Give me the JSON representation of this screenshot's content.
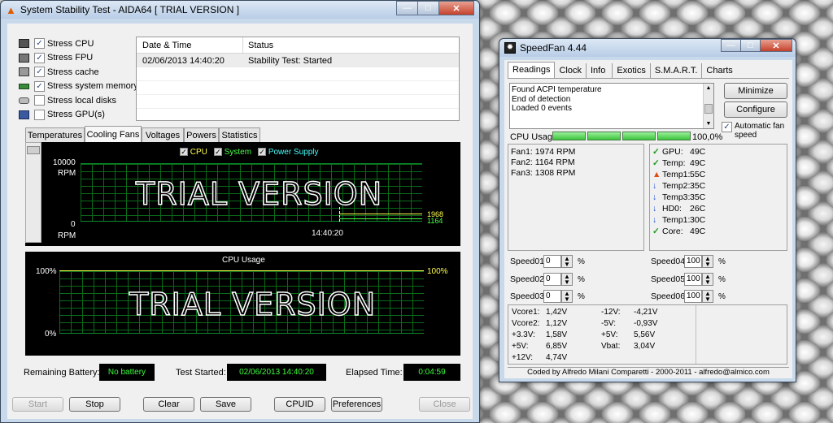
{
  "aida": {
    "title": "System Stability Test - AIDA64  [ TRIAL VERSION ]",
    "stress": [
      "Stress CPU",
      "Stress FPU",
      "Stress cache",
      "Stress system memory",
      "Stress local disks",
      "Stress GPU(s)"
    ],
    "stress_checked": [
      true,
      true,
      true,
      true,
      false,
      false
    ],
    "log_headers": [
      "Date & Time",
      "Status"
    ],
    "log": [
      {
        "time": "02/06/2013 14:40:20",
        "status": "Stability Test: Started"
      }
    ],
    "tabs": [
      "Temperatures",
      "Cooling Fans",
      "Voltages",
      "Powers",
      "Statistics"
    ],
    "active_tab": "Cooling Fans",
    "fan_legend": [
      "CPU",
      "System",
      "Power Supply"
    ],
    "fan_y_top": "10000",
    "fan_y_unit": "RPM",
    "fan_y_bottom": "0",
    "fan_y_bottom_unit": "RPM",
    "fan_time": "14:40:20",
    "fan_v1": "1968",
    "fan_v2": "1164",
    "trial": "TRIAL VERSION",
    "cpu_title": "CPU Usage",
    "cpu_top": "100%",
    "cpu_bottom": "0%",
    "cpu_right": "100%",
    "battery_label": "Remaining Battery:",
    "battery_value": "No battery",
    "started_label": "Test Started:",
    "started_value": "02/06/2013 14:40:20",
    "elapsed_label": "Elapsed Time:",
    "elapsed_value": "0:04:59",
    "buttons": {
      "start": "Start",
      "stop": "Stop",
      "clear": "Clear",
      "save": "Save",
      "cpuid": "CPUID",
      "prefs": "Preferences",
      "close": "Close"
    }
  },
  "speedfan": {
    "title": "SpeedFan 4.44",
    "tabs": [
      "Readings",
      "Clock",
      "Info",
      "Exotics",
      "S.M.A.R.T.",
      "Charts"
    ],
    "log": [
      "Found ACPI temperature",
      "End of detection",
      "Loaded 0 events"
    ],
    "minimize": "Minimize",
    "configure": "Configure",
    "auto_fan": "Automatic fan speed",
    "cpu_usage_label": "CPU Usage",
    "cpu_usage_value": "100,0%",
    "fans": [
      "Fan1: 1974 RPM",
      "Fan2: 1164 RPM",
      "Fan3: 1308 RPM"
    ],
    "temps": [
      {
        "icon": "ok",
        "label": "GPU:",
        "value": "49C"
      },
      {
        "icon": "ok",
        "label": "Temp:",
        "value": "49C"
      },
      {
        "icon": "hot",
        "label": "Temp1:",
        "value": "55C"
      },
      {
        "icon": "down",
        "label": "Temp2:",
        "value": "35C"
      },
      {
        "icon": "down",
        "label": "Temp3:",
        "value": "35C"
      },
      {
        "icon": "down",
        "label": "HD0:",
        "value": "26C"
      },
      {
        "icon": "down",
        "label": "Temp1:",
        "value": "30C"
      },
      {
        "icon": "ok",
        "label": "Core:",
        "value": "49C"
      }
    ],
    "speeds_left": [
      {
        "label": "Speed01:",
        "value": "0"
      },
      {
        "label": "Speed02:",
        "value": "0"
      },
      {
        "label": "Speed03:",
        "value": "0"
      }
    ],
    "speeds_right": [
      {
        "label": "Speed04:",
        "value": "100"
      },
      {
        "label": "Speed05:",
        "value": "100"
      },
      {
        "label": "Speed06:",
        "value": "100"
      }
    ],
    "pct": "%",
    "volts_left": [
      {
        "label": "Vcore1:",
        "value": "1,42V"
      },
      {
        "label": "Vcore2:",
        "value": "1,12V"
      },
      {
        "label": "+3.3V:",
        "value": "1,58V"
      },
      {
        "label": "+5V:",
        "value": "6,85V"
      },
      {
        "label": "+12V:",
        "value": "4,74V"
      }
    ],
    "volts_right": [
      {
        "label": "-12V:",
        "value": "-4,21V"
      },
      {
        "label": "-5V:",
        "value": "-0,93V"
      },
      {
        "label": "+5V:",
        "value": "5,56V"
      },
      {
        "label": "Vbat:",
        "value": "3,04V"
      }
    ],
    "footer": "Coded by Alfredo Milani Comparetti - 2000-2011 - alfredo@almico.com"
  }
}
